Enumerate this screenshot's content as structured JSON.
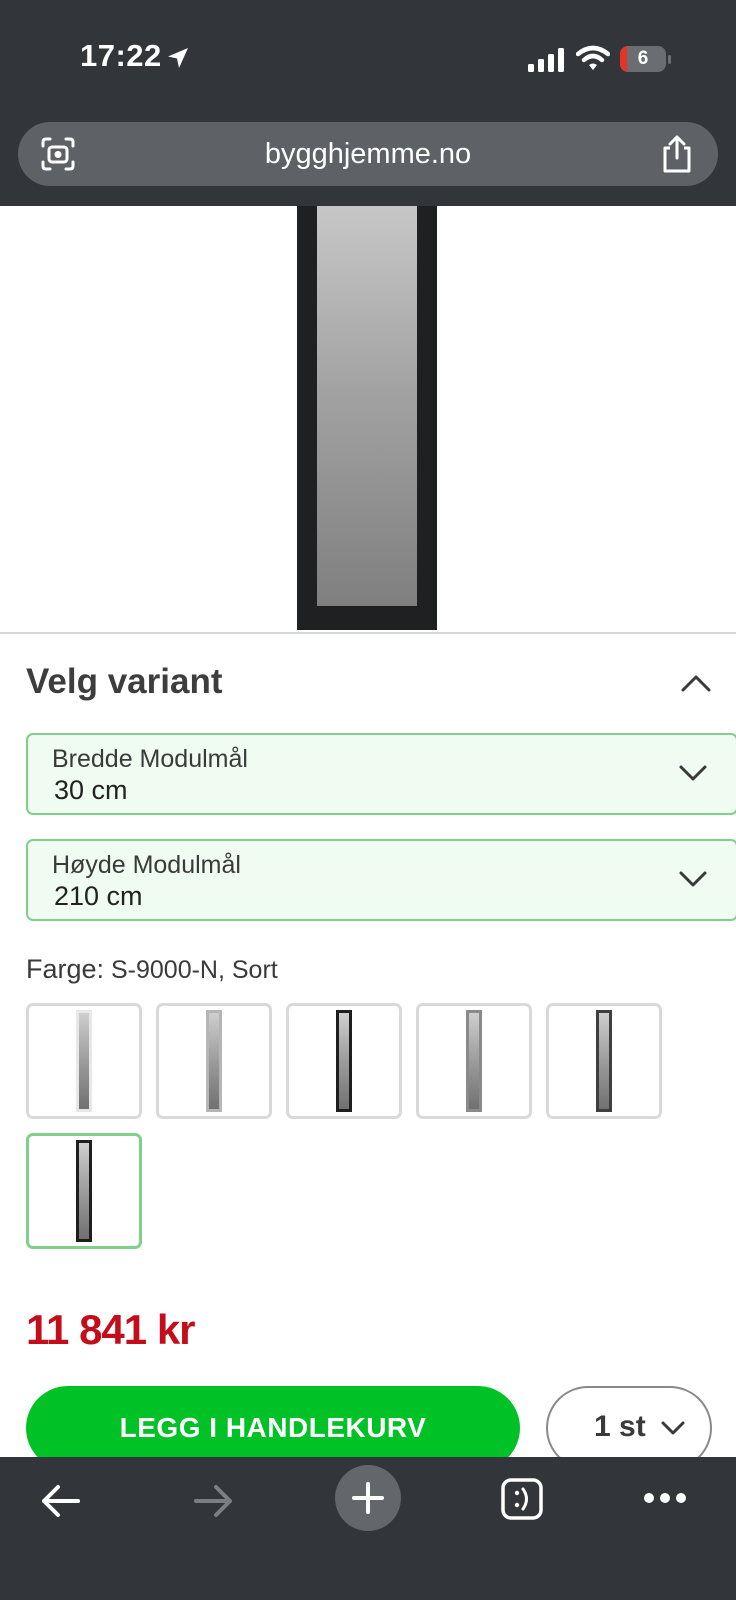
{
  "status_bar": {
    "time": "17:22",
    "battery": "6",
    "icons": [
      "location-arrow-icon",
      "signal-icon",
      "wifi-icon",
      "battery-icon"
    ]
  },
  "url_bar": {
    "url": "bygghjemme.no",
    "icons": [
      "lens-icon",
      "share-icon"
    ]
  },
  "variant": {
    "title": "Velg variant",
    "width_select": {
      "label": "Bredde Modulmål",
      "value": "30 cm"
    },
    "height_select": {
      "label": "Høyde Modulmål",
      "value": "210 cm"
    },
    "color": {
      "label": "Farge:",
      "value": " S-9000-N, Sort"
    },
    "swatches": [
      {
        "frame": "#e7e7e7",
        "selected": false
      },
      {
        "frame": "#b5b5b5",
        "selected": false
      },
      {
        "frame": "#1e1e1e",
        "selected": false
      },
      {
        "frame": "#8a8a8a",
        "selected": false
      },
      {
        "frame": "#3f3f3f",
        "selected": false
      },
      {
        "frame": "#1e1e1e",
        "selected": true
      }
    ]
  },
  "price": "11 841 kr",
  "buy": {
    "add_to_cart_label": "LEGG I HANDLEKURV",
    "quantity": "1 st"
  },
  "colors": {
    "accent_green": "#00c227",
    "price_red": "#c40d1a",
    "select_border": "#7fd08a",
    "select_bg": "#f0fbf1",
    "chrome": "#32353a"
  }
}
